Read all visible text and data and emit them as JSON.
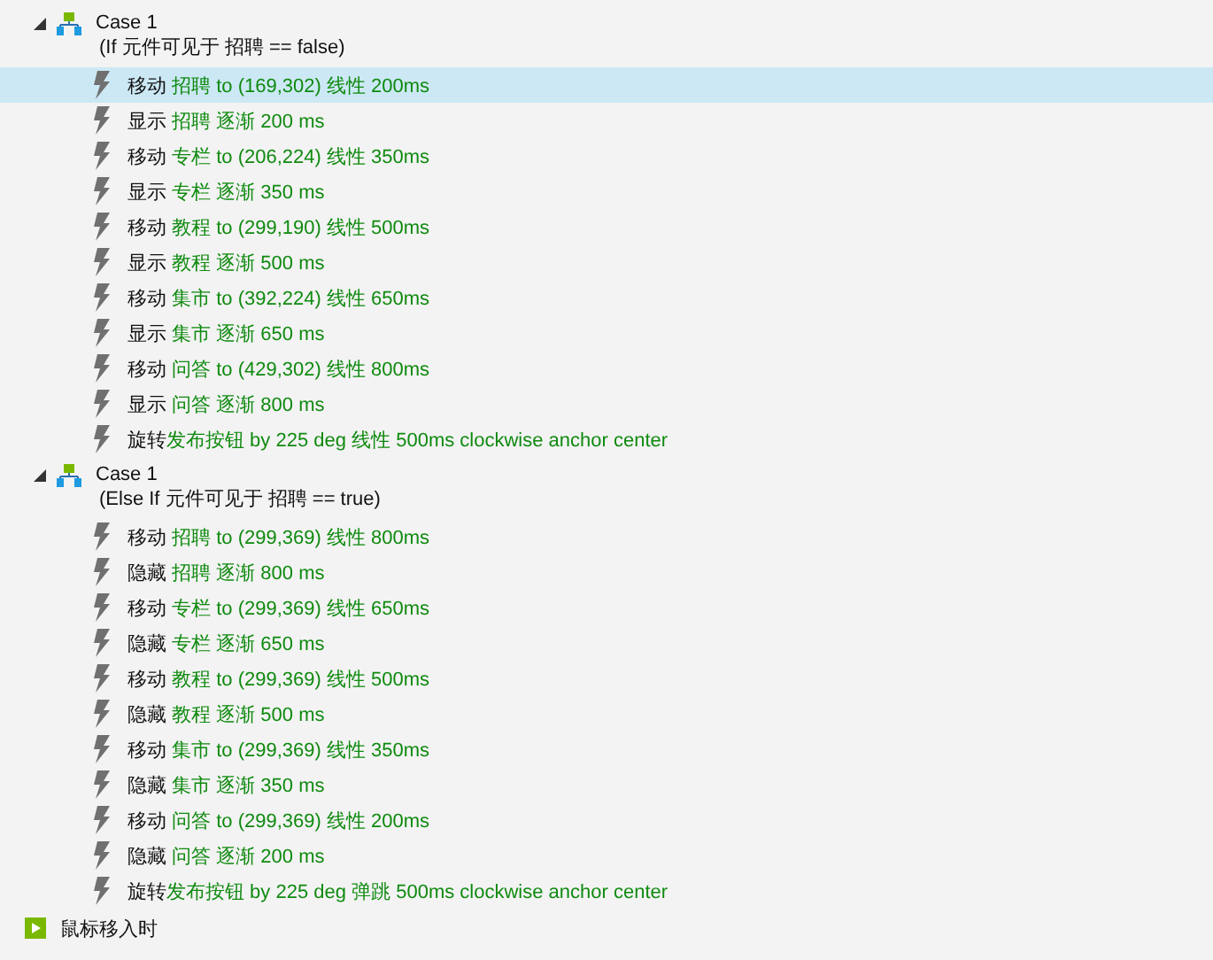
{
  "cases": [
    {
      "title": "Case 1",
      "condition": "(If 元件可见于 招聘 == false)",
      "expanded": true,
      "actions": [
        {
          "verb": "移动",
          "detail": "招聘 to (169,302) 线性 200ms",
          "spaced": true,
          "selected": true
        },
        {
          "verb": "显示",
          "detail": "招聘 逐渐 200 ms",
          "spaced": true,
          "selected": false
        },
        {
          "verb": "移动",
          "detail": "专栏 to (206,224) 线性 350ms",
          "spaced": true,
          "selected": false
        },
        {
          "verb": "显示",
          "detail": "专栏 逐渐 350 ms",
          "spaced": true,
          "selected": false
        },
        {
          "verb": "移动",
          "detail": "教程 to (299,190) 线性 500ms",
          "spaced": true,
          "selected": false
        },
        {
          "verb": "显示",
          "detail": "教程 逐渐 500 ms",
          "spaced": true,
          "selected": false
        },
        {
          "verb": "移动",
          "detail": "集市 to (392,224) 线性 650ms",
          "spaced": true,
          "selected": false
        },
        {
          "verb": "显示",
          "detail": "集市 逐渐 650 ms",
          "spaced": true,
          "selected": false
        },
        {
          "verb": "移动",
          "detail": "问答 to (429,302) 线性 800ms",
          "spaced": true,
          "selected": false
        },
        {
          "verb": "显示",
          "detail": "问答 逐渐 800 ms",
          "spaced": true,
          "selected": false
        },
        {
          "verb": "旋转",
          "detail": "发布按钮 by 225 deg 线性 500ms clockwise anchor center",
          "spaced": false,
          "selected": false
        }
      ]
    },
    {
      "title": "Case 1",
      "condition": "(Else If 元件可见于 招聘 == true)",
      "expanded": true,
      "actions": [
        {
          "verb": "移动",
          "detail": "招聘 to (299,369) 线性 800ms",
          "spaced": true,
          "selected": false
        },
        {
          "verb": "隐藏",
          "detail": "招聘 逐渐 800 ms",
          "spaced": true,
          "selected": false
        },
        {
          "verb": "移动",
          "detail": "专栏 to (299,369) 线性 650ms",
          "spaced": true,
          "selected": false
        },
        {
          "verb": "隐藏",
          "detail": "专栏 逐渐 650 ms",
          "spaced": true,
          "selected": false
        },
        {
          "verb": "移动",
          "detail": "教程 to (299,369) 线性 500ms",
          "spaced": true,
          "selected": false
        },
        {
          "verb": "隐藏",
          "detail": "教程 逐渐 500 ms",
          "spaced": true,
          "selected": false
        },
        {
          "verb": "移动",
          "detail": "集市 to (299,369) 线性 350ms",
          "spaced": true,
          "selected": false
        },
        {
          "verb": "隐藏",
          "detail": "集市 逐渐 350 ms",
          "spaced": true,
          "selected": false
        },
        {
          "verb": "移动",
          "detail": "问答 to (299,369) 线性 200ms",
          "spaced": true,
          "selected": false
        },
        {
          "verb": "隐藏",
          "detail": "问答 逐渐 200 ms",
          "spaced": true,
          "selected": false
        },
        {
          "verb": "旋转",
          "detail": "发布按钮 by 225 deg 弹跳 500ms clockwise anchor center",
          "spaced": false,
          "selected": false
        }
      ]
    }
  ],
  "event": {
    "label": "鼠标移入时"
  }
}
